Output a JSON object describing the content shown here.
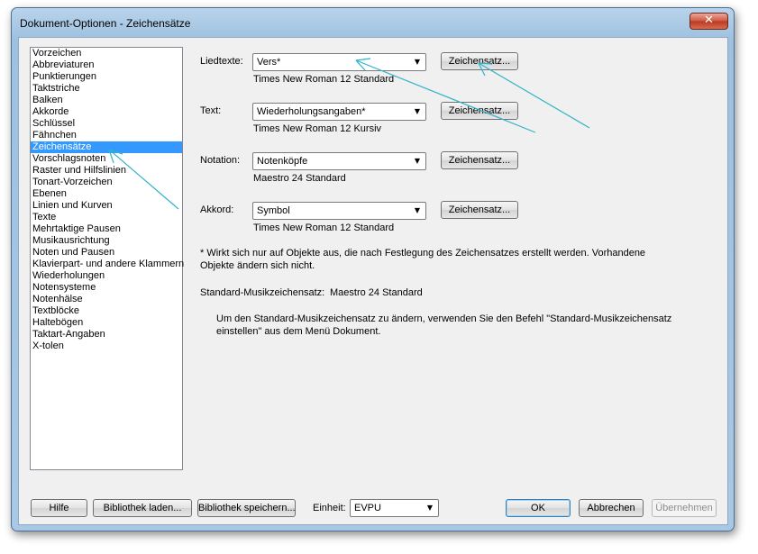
{
  "window": {
    "title": "Dokument-Optionen - Zeichensätze",
    "close_glyph": "✕"
  },
  "sidebar": {
    "items": [
      {
        "label": "Vorzeichen",
        "selected": false
      },
      {
        "label": "Abbreviaturen",
        "selected": false
      },
      {
        "label": "Punktierungen",
        "selected": false
      },
      {
        "label": "Taktstriche",
        "selected": false
      },
      {
        "label": "Balken",
        "selected": false
      },
      {
        "label": "Akkorde",
        "selected": false
      },
      {
        "label": "Schlüssel",
        "selected": false
      },
      {
        "label": "Fähnchen",
        "selected": false
      },
      {
        "label": "Zeichensätze",
        "selected": true
      },
      {
        "label": "Vorschlagsnoten",
        "selected": false
      },
      {
        "label": "Raster und Hilfslinien",
        "selected": false
      },
      {
        "label": "Tonart-Vorzeichen",
        "selected": false
      },
      {
        "label": "Ebenen",
        "selected": false
      },
      {
        "label": "Linien und Kurven",
        "selected": false
      },
      {
        "label": "Texte",
        "selected": false
      },
      {
        "label": "Mehrtaktige Pausen",
        "selected": false
      },
      {
        "label": "Musikausrichtung",
        "selected": false
      },
      {
        "label": "Noten und Pausen",
        "selected": false
      },
      {
        "label": "Klavierpart- und andere Klammern",
        "selected": false
      },
      {
        "label": "Wiederholungen",
        "selected": false
      },
      {
        "label": "Notensysteme",
        "selected": false
      },
      {
        "label": "Notenhälse",
        "selected": false
      },
      {
        "label": "Textblöcke",
        "selected": false
      },
      {
        "label": "Haltebögen",
        "selected": false
      },
      {
        "label": "Taktart-Angaben",
        "selected": false
      },
      {
        "label": "X-tolen",
        "selected": false
      }
    ]
  },
  "fonts": {
    "rows": [
      {
        "label": "Liedtexte:",
        "select_value": "Vers*",
        "button": "Zeichensatz...",
        "font_desc": "Times New Roman 12 Standard"
      },
      {
        "label": "Text:",
        "select_value": "Wiederholungsangaben*",
        "button": "Zeichensatz...",
        "font_desc": "Times New Roman 12 Kursiv"
      },
      {
        "label": "Notation:",
        "select_value": "Notenköpfe",
        "button": "Zeichensatz...",
        "font_desc": "Maestro 24 Standard"
      },
      {
        "label": "Akkord:",
        "select_value": "Symbol",
        "button": "Zeichensatz...",
        "font_desc": "Times New Roman 12 Standard"
      }
    ],
    "footnote": "* Wirkt sich nur auf Objekte aus, die nach Festlegung des Zeichensatzes erstellt werden. Vorhandene Objekte ändern sich nicht.",
    "std_label": "Standard-Musikzeichensatz:",
    "std_value": "Maestro 24 Standard",
    "std_help": "Um den Standard-Musikzeichensatz zu ändern, verwenden Sie den Befehl \"Standard-Musikzeichensatz einstellen\" aus dem Menü Dokument."
  },
  "footer": {
    "help": "Hilfe",
    "load_library": "Bibliothek laden...",
    "save_library": "Bibliothek speichern...",
    "unit_label": "Einheit:",
    "unit_value": "EVPU",
    "ok": "OK",
    "cancel": "Abbrechen",
    "apply": "Übernehmen"
  },
  "colors": {
    "selection": "#3399ff",
    "annotation_arrow": "#2fb3c9"
  }
}
